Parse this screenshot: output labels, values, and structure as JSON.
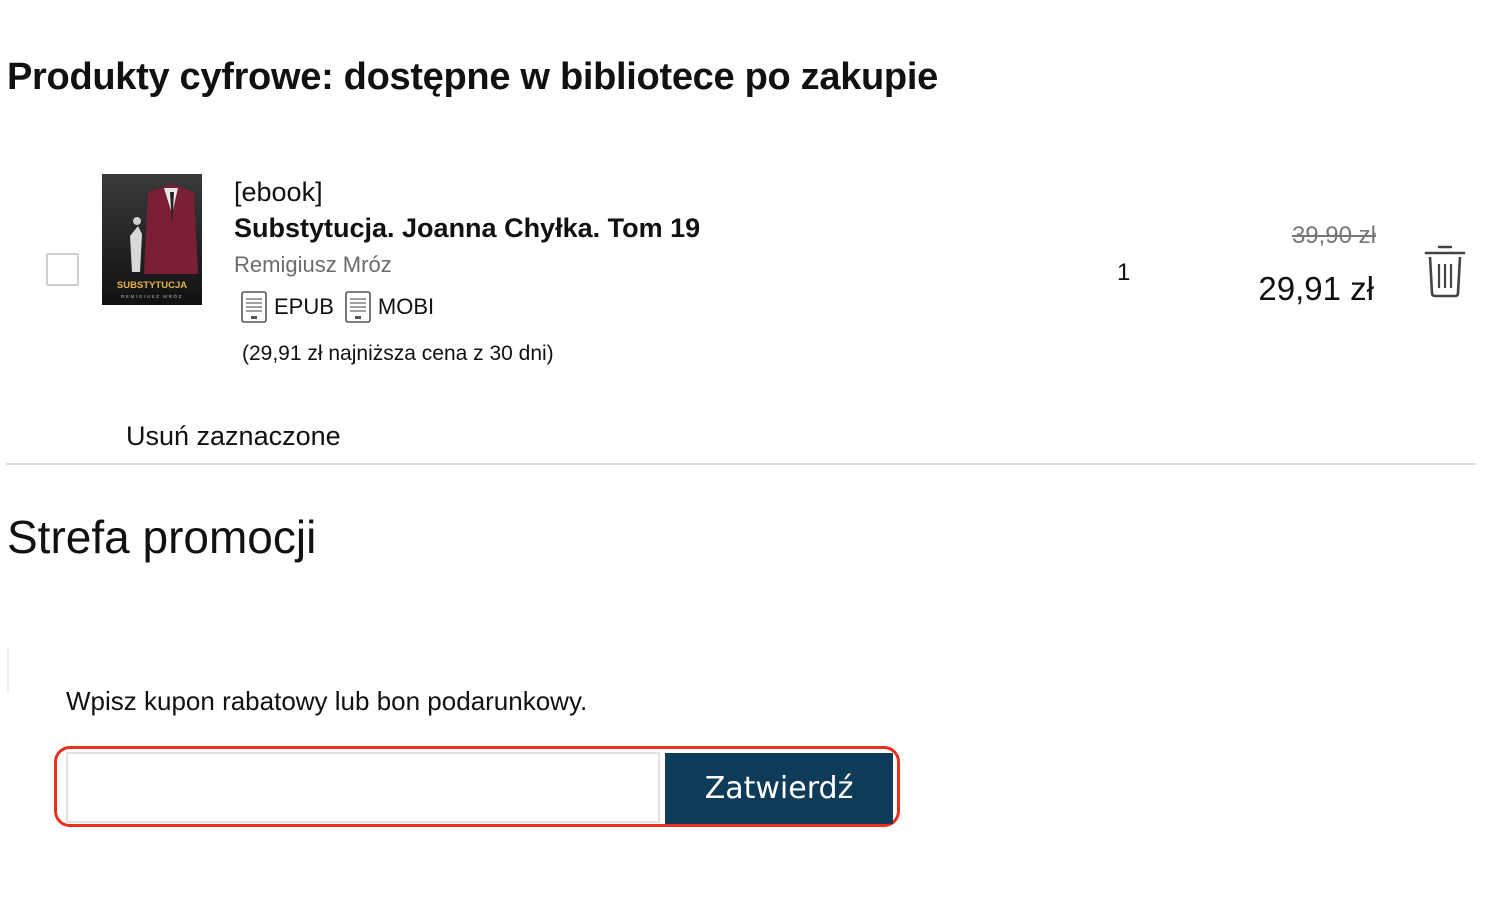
{
  "digital_section": {
    "title": "Produkty cyfrowe: dostępne w bibliotece po zakupie"
  },
  "cart_item": {
    "type": "[ebook]",
    "title": "Substytucja. Joanna Chyłka. Tom 19",
    "author": "Remigiusz Mróz",
    "cover_title": "SUBSTYTUCJA",
    "cover_author": "REMIGIUSZ MRÓZ",
    "formats": [
      "EPUB",
      "MOBI"
    ],
    "lowest_price_note": "(29,91 zł najniższa cena z 30 dni)",
    "quantity": "1",
    "old_price": "39,90 zł",
    "price": "29,91 zł",
    "selected": false
  },
  "actions": {
    "remove_selected": "Usuń zaznaczone"
  },
  "promo": {
    "title": "Strefa promocji",
    "coupon_label": "Wpisz kupon rabatowy lub bon podarunkowy.",
    "coupon_value": "",
    "coupon_placeholder": "",
    "submit_label": "Zatwierdź"
  },
  "colors": {
    "button_bg": "#0e3b57",
    "highlight_border": "#e8301c",
    "old_price": "#777777",
    "author": "#6b6b6b"
  },
  "icons": {
    "trash": "trash-icon",
    "format": "document-icon"
  }
}
